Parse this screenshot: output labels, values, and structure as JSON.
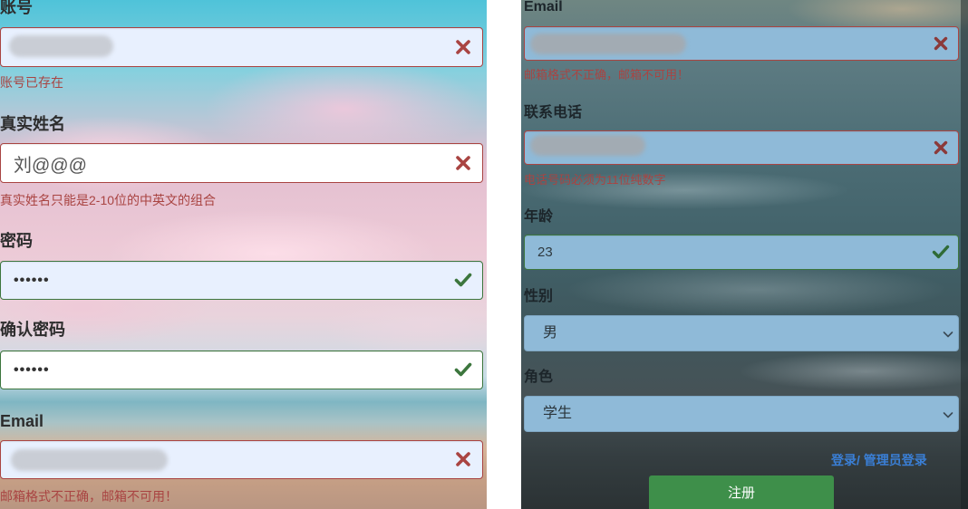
{
  "left_form": {
    "account": {
      "label": "账号",
      "value": "",
      "status": "error",
      "error": "账号已存在"
    },
    "real_name": {
      "label": "真实姓名",
      "value": "刘@@@",
      "status": "error",
      "error": "真实姓名只能是2-10位的中英文的组合"
    },
    "password": {
      "label": "密码",
      "value": "••••••",
      "status": "success"
    },
    "confirm_password": {
      "label": "确认密码",
      "value": "••••••",
      "status": "success"
    },
    "email": {
      "label": "Email",
      "value": "",
      "status": "error",
      "error": "邮箱格式不正确，邮箱不可用！"
    }
  },
  "right_form": {
    "email": {
      "label": "Email",
      "value": "",
      "status": "error",
      "error": "邮箱格式不正确，邮箱不可用！"
    },
    "phone": {
      "label": "联系电话",
      "value": "",
      "status": "error",
      "error": "电话号码必须为11位纯数字"
    },
    "age": {
      "label": "年龄",
      "value": "23",
      "status": "success"
    },
    "gender": {
      "label": "性别",
      "selected": "男"
    },
    "role": {
      "label": "角色",
      "selected": "学生"
    },
    "links": {
      "login": "登录/",
      "admin_login": "管理员登录"
    },
    "register_button": "注册"
  },
  "icons": {
    "error": "times-icon",
    "success": "check-icon",
    "select": "chevron-down-icon"
  },
  "colors": {
    "error": "#a94442",
    "success": "#3c763d",
    "link": "#3a7fd6",
    "button": "#3e8f4a",
    "autofill_bg": "#e8f0fe",
    "right_input_bg": "#8fbad8"
  }
}
